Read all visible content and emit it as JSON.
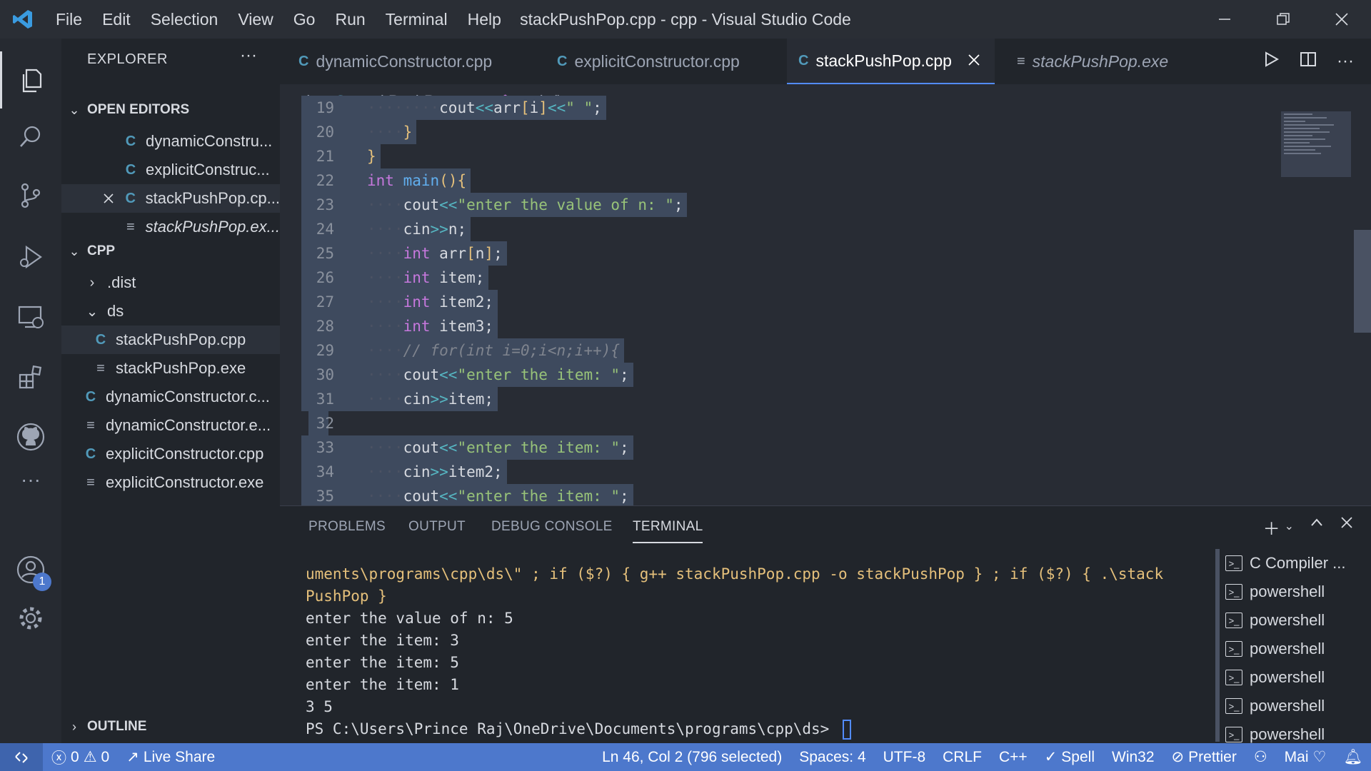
{
  "window": {
    "title": "stackPushPop.cpp - cpp - Visual Studio Code",
    "menu": [
      "File",
      "Edit",
      "Selection",
      "View",
      "Go",
      "Run",
      "Terminal",
      "Help"
    ]
  },
  "activity": {
    "accounts_badge": "1",
    "more": "···"
  },
  "sidebar": {
    "title": "EXPLORER",
    "more": "···",
    "open_editors": {
      "header": "OPEN EDITORS",
      "items": [
        {
          "label": "dynamicConstru...",
          "type": "cpp"
        },
        {
          "label": "explicitConstruc...",
          "type": "cpp"
        },
        {
          "label": "stackPushPop.cp...",
          "type": "cpp",
          "active": true
        },
        {
          "label": "stackPushPop.ex...",
          "type": "exe",
          "italic": true
        }
      ]
    },
    "folder": {
      "header": "CPP",
      "items": [
        {
          "label": ".dist",
          "kind": "folder-collapsed"
        },
        {
          "label": "ds",
          "kind": "folder-expanded"
        },
        {
          "label": "stackPushPop.cpp",
          "type": "cpp"
        },
        {
          "label": "stackPushPop.exe",
          "type": "exe"
        },
        {
          "label": "dynamicConstructor.c...",
          "type": "cpp"
        },
        {
          "label": "dynamicConstructor.e...",
          "type": "exe"
        },
        {
          "label": "explicitConstructor.cpp",
          "type": "cpp"
        },
        {
          "label": "explicitConstructor.exe",
          "type": "exe"
        }
      ]
    },
    "outline": "OUTLINE"
  },
  "tabs": [
    {
      "label": "dynamicConstructor.cpp",
      "type": "cpp"
    },
    {
      "label": "explicitConstructor.cpp",
      "type": "cpp"
    },
    {
      "label": "stackPushPop.cpp",
      "type": "cpp",
      "active": true
    },
    {
      "label": "stackPushPop.exe",
      "type": "exe",
      "italic": true
    }
  ],
  "breadcrumb": {
    "folder": "ds",
    "file": "stackPushPop.cpp",
    "symbol": "main()"
  },
  "code_lines": [
    {
      "n": "19",
      "text": "        cout<<arr[i]<<\" \";"
    },
    {
      "n": "20",
      "text": "    }"
    },
    {
      "n": "21",
      "text": "}"
    },
    {
      "n": "22",
      "text": "int main(){"
    },
    {
      "n": "23",
      "text": "    cout<<\"enter the value of n: \";"
    },
    {
      "n": "24",
      "text": "    cin>>n;"
    },
    {
      "n": "25",
      "text": "    int arr[n];"
    },
    {
      "n": "26",
      "text": "    int item;"
    },
    {
      "n": "27",
      "text": "    int item2;"
    },
    {
      "n": "28",
      "text": "    int item3;"
    },
    {
      "n": "29",
      "text": "    // for(int i=0;i<n;i++){"
    },
    {
      "n": "30",
      "text": "    cout<<\"enter the item: \";"
    },
    {
      "n": "31",
      "text": "    cin>>item;"
    },
    {
      "n": "32",
      "text": ""
    },
    {
      "n": "33",
      "text": "    cout<<\"enter the item: \";"
    },
    {
      "n": "34",
      "text": "    cin>>item2;"
    },
    {
      "n": "35",
      "text": "    cout<<\"enter the item: \";"
    }
  ],
  "panel": {
    "tabs": [
      "PROBLEMS",
      "OUTPUT",
      "DEBUG CONSOLE",
      "TERMINAL"
    ],
    "active_tab": "TERMINAL",
    "terminal_lines": [
      "uments\\programs\\cpp\\ds\\\" ; if ($?) { g++ stackPushPop.cpp -o stackPushPop } ; if ($?) { .\\stack",
      "PushPop }",
      "enter the value of n: 5",
      "enter the item: 3",
      "enter the item: 5",
      "enter the item: 1",
      "3 5",
      "PS C:\\Users\\Prince Raj\\OneDrive\\Documents\\programs\\cpp\\ds> "
    ],
    "terminals": [
      "C Compiler ...",
      "powershell",
      "powershell",
      "powershell",
      "powershell",
      "powershell",
      "powershell"
    ]
  },
  "status": {
    "errors": "0",
    "warnings": "0",
    "live_share": "Live Share",
    "position": "Ln 46, Col 2 (796 selected)",
    "spaces": "Spaces: 4",
    "encoding": "UTF-8",
    "eol": "CRLF",
    "language": "C++",
    "spell": "Spell",
    "platform": "Win32",
    "prettier": "Prettier",
    "user": "Mai"
  }
}
